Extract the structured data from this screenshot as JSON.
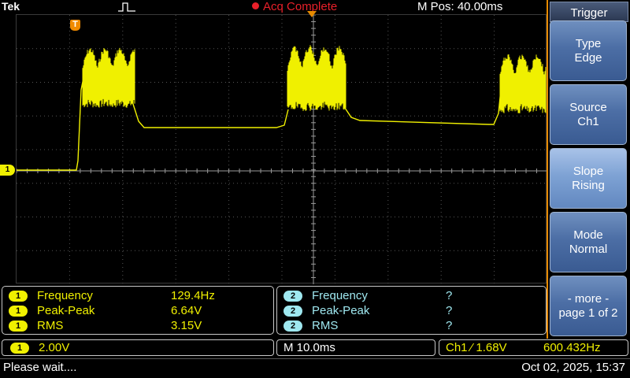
{
  "topbar": {
    "brand": "Tek",
    "acq_status": "Acq Complete",
    "m_pos": "M Pos: 40.00ms"
  },
  "markers": {
    "ch1_level_label": "1",
    "trigger_label": "T"
  },
  "trigger_menu": {
    "title": "Trigger",
    "buttons": [
      {
        "line1": "Type",
        "line2": "Edge"
      },
      {
        "line1": "Source",
        "line2": "Ch1"
      },
      {
        "line1": "Slope",
        "line2": "Rising"
      },
      {
        "line1": "Mode",
        "line2": "Normal"
      },
      {
        "line1": "- more -",
        "line2": "page 1 of 2"
      }
    ]
  },
  "measurements": {
    "ch1": [
      {
        "channel": "1",
        "name": "Frequency",
        "value": "129.4Hz"
      },
      {
        "channel": "1",
        "name": "Peak-Peak",
        "value": "6.64V"
      },
      {
        "channel": "1",
        "name": "RMS",
        "value": "3.15V"
      }
    ],
    "ch2": [
      {
        "channel": "2",
        "name": "Frequency",
        "value": "?"
      },
      {
        "channel": "2",
        "name": "Peak-Peak",
        "value": "?"
      },
      {
        "channel": "2",
        "name": "RMS",
        "value": "?"
      }
    ]
  },
  "status": {
    "ch_badge": "1",
    "volts_div": "2.00V",
    "time_div": "M 10.0ms",
    "trig_readout": "Ch1 ⁄ 1.68V",
    "trig_freq": "600.432Hz"
  },
  "message": "Please wait....",
  "datetime": "Oct 02, 2025, 15:37",
  "colors": {
    "ch1": "#f0f000",
    "ch2": "#9fe8f0",
    "accent": "#e68a00",
    "acq": "#e8202a"
  }
}
